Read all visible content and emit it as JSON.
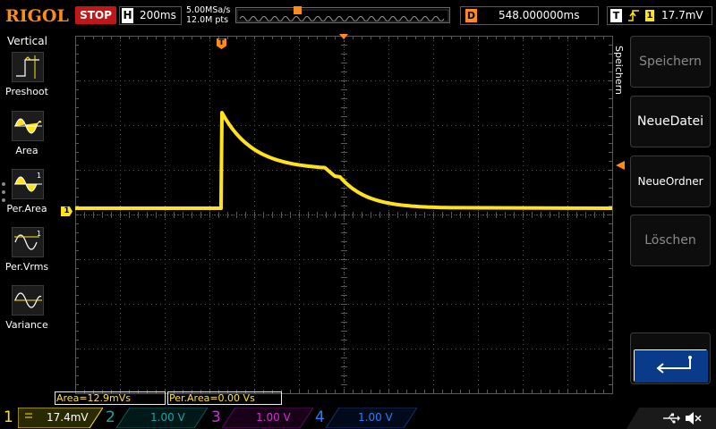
{
  "brand": "RIGOL",
  "run_state": "STOP",
  "horizontal": {
    "label": "H",
    "timebase": "200ms"
  },
  "acquisition": {
    "sample_rate": "5.00MSa/s",
    "memory_depth": "12.0M pts"
  },
  "delay": {
    "label": "D",
    "value": "548.000000ms"
  },
  "trigger": {
    "label": "T",
    "source": "1",
    "level": "17.7mV"
  },
  "left_menu": {
    "title": "Vertical",
    "items": [
      {
        "label": "Preshoot",
        "icon": "preshoot-icon"
      },
      {
        "label": "Area",
        "icon": "area-icon"
      },
      {
        "label": "Per.Area",
        "icon": "period-area-icon"
      },
      {
        "label": "Per.Vrms",
        "icon": "period-vrms-icon"
      },
      {
        "label": "Variance",
        "icon": "variance-icon"
      }
    ]
  },
  "right_menu": {
    "title": "Speichern",
    "items": [
      {
        "label": "Speichern",
        "enabled": false
      },
      {
        "label": "NeueDatei",
        "enabled": true
      },
      {
        "label": "NeueOrdner",
        "enabled": true
      },
      {
        "label": "Löschen",
        "enabled": false
      }
    ],
    "back_icon": "return-arrow-icon"
  },
  "markers": {
    "channel1": "1",
    "trigger_pos": "T"
  },
  "measurements": [
    "Area=12.9mVs",
    "Per.Area=0.00 Vs"
  ],
  "channels": [
    {
      "num": "1",
      "value": "17.4mV",
      "color": "#ffe31a",
      "active": true
    },
    {
      "num": "2",
      "value": "1.00 V",
      "color": "#18a6a6",
      "active": false
    },
    {
      "num": "3",
      "value": "1.00 V",
      "color": "#d030d0",
      "active": false
    },
    {
      "num": "4",
      "value": "1.00 V",
      "color": "#2a7fff",
      "active": false
    }
  ],
  "status_icons": [
    "usb-icon",
    "speaker-muted-icon"
  ],
  "colors": {
    "accent": "#ff8c1a",
    "trace": "#ffe31a",
    "stop": "#c01818",
    "grid": "#5a5a5a"
  }
}
